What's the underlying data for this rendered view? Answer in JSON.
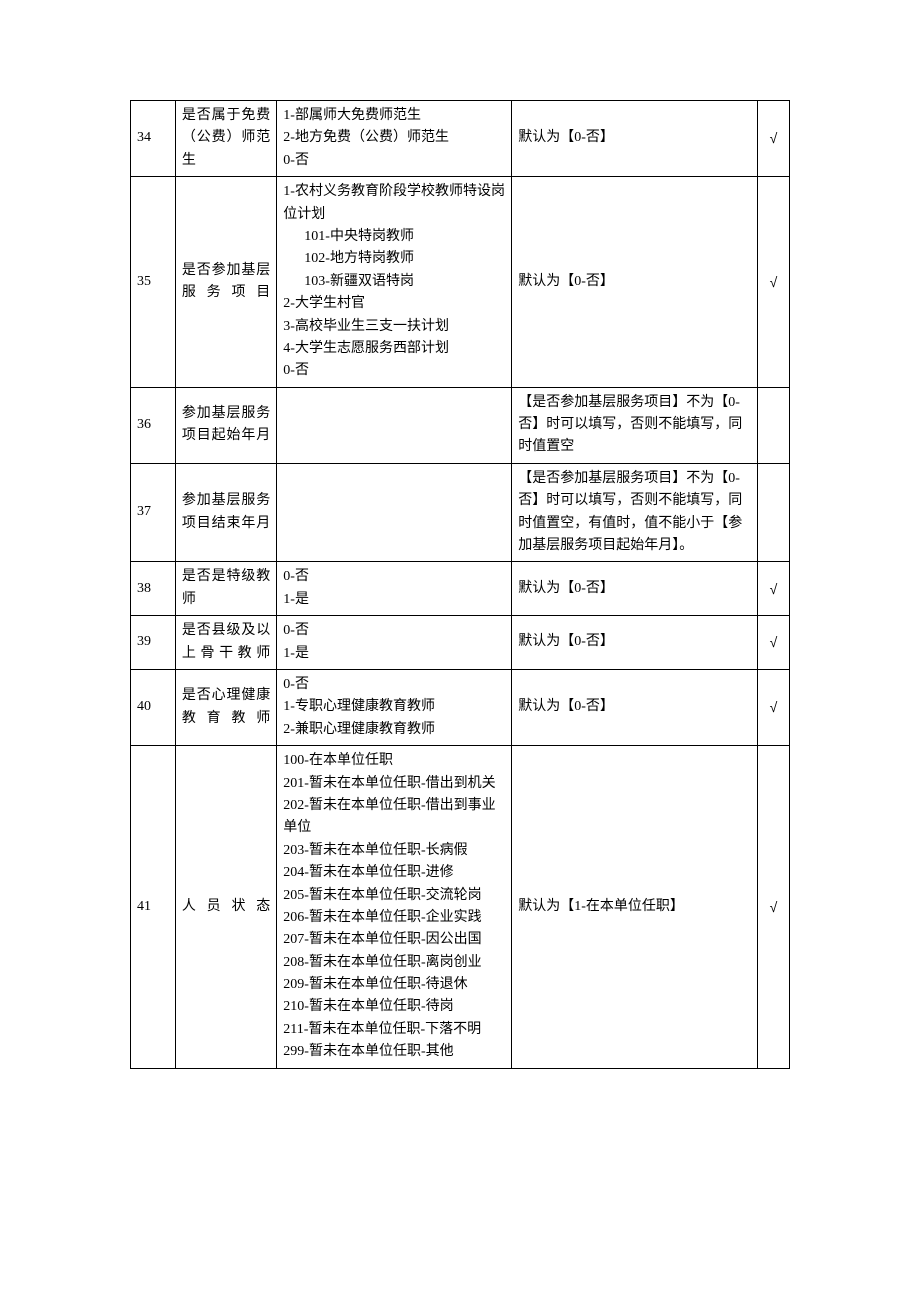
{
  "rows": [
    {
      "num": "34",
      "field": "是否属于免费（公费）师范生",
      "options": "1-部属师大免费师范生\n2-地方免费（公费）师范生\n0-否",
      "remark": "默认为【0-否】",
      "req": "√"
    },
    {
      "num": "35",
      "field": "是否参加基层服务项目",
      "options": "1-农村义务教育阶段学校教师特设岗位计划\n   101-中央特岗教师\n   102-地方特岗教师\n   103-新疆双语特岗\n2-大学生村官\n3-高校毕业生三支一扶计划\n4-大学生志愿服务西部计划\n0-否",
      "remark": "默认为【0-否】",
      "req": "√"
    },
    {
      "num": "36",
      "field": "参加基层服务项目起始年月",
      "options": "",
      "remark": "【是否参加基层服务项目】不为【0-否】时可以填写，否则不能填写，同时值置空",
      "req": ""
    },
    {
      "num": "37",
      "field": "参加基层服务项目结束年月",
      "options": "",
      "remark": "【是否参加基层服务项目】不为【0-否】时可以填写，否则不能填写，同时值置空，有值时，值不能小于【参加基层服务项目起始年月】。",
      "req": ""
    },
    {
      "num": "38",
      "field": "是否是特级教师",
      "options": "0-否\n1-是",
      "remark": "默认为【0-否】",
      "req": "√"
    },
    {
      "num": "39",
      "field": "是否县级及以上骨干教师",
      "options": "0-否\n1-是",
      "remark": "默认为【0-否】",
      "req": "√"
    },
    {
      "num": "40",
      "field": "是否心理健康教育教师",
      "options": "0-否\n1-专职心理健康教育教师\n2-兼职心理健康教育教师",
      "remark": "默认为【0-否】",
      "req": "√"
    },
    {
      "num": "41",
      "field": "人员状态",
      "options": "100-在本单位任职\n201-暂未在本单位任职-借出到机关\n202-暂未在本单位任职-借出到事业单位\n203-暂未在本单位任职-长病假\n204-暂未在本单位任职-进修\n205-暂未在本单位任职-交流轮岗\n206-暂未在本单位任职-企业实践\n207-暂未在本单位任职-因公出国\n208-暂未在本单位任职-离岗创业\n209-暂未在本单位任职-待退休\n210-暂未在本单位任职-待岗\n211-暂未在本单位任职-下落不明\n299-暂未在本单位任职-其他",
      "remark": "默认为【1-在本单位任职】",
      "req": "√"
    }
  ]
}
